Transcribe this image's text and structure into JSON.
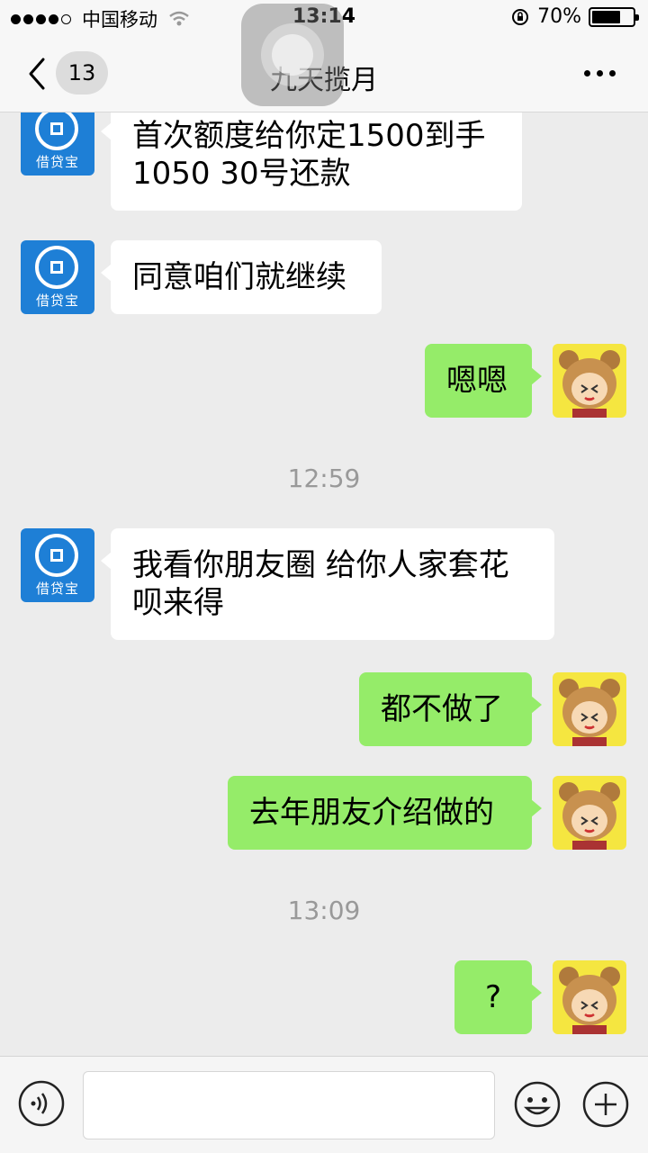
{
  "status_bar": {
    "carrier": "中国移动",
    "time": "13:14",
    "battery": "70%",
    "battery_level": 0.7
  },
  "nav": {
    "back_count": "13",
    "title": "九天揽月"
  },
  "contact": {
    "avatar_text": "借贷宝"
  },
  "messages": [
    {
      "side": "left",
      "text": "首次额度给你定1500到手1050  30号还款"
    },
    {
      "side": "left",
      "text": "同意咱们就继续"
    },
    {
      "side": "right",
      "text": "嗯嗯"
    },
    {
      "type": "time",
      "text": "12:59"
    },
    {
      "side": "left",
      "text": "我看你朋友圈 给你人家套花呗来得"
    },
    {
      "side": "right",
      "text": "都不做了"
    },
    {
      "side": "right",
      "text": "去年朋友介绍做的"
    },
    {
      "type": "time",
      "text": "13:09"
    },
    {
      "side": "right",
      "text": "?"
    }
  ],
  "colors": {
    "sent_bubble": "#95ec69",
    "received_bubble": "#ffffff",
    "chat_background": "#ececec",
    "contact_avatar": "#1e7fd6"
  },
  "icons": {
    "back": "chevron-left-icon",
    "more": "more-horizontal-icon",
    "voice": "voice-icon",
    "emoji": "emoji-icon",
    "plus": "plus-icon"
  }
}
